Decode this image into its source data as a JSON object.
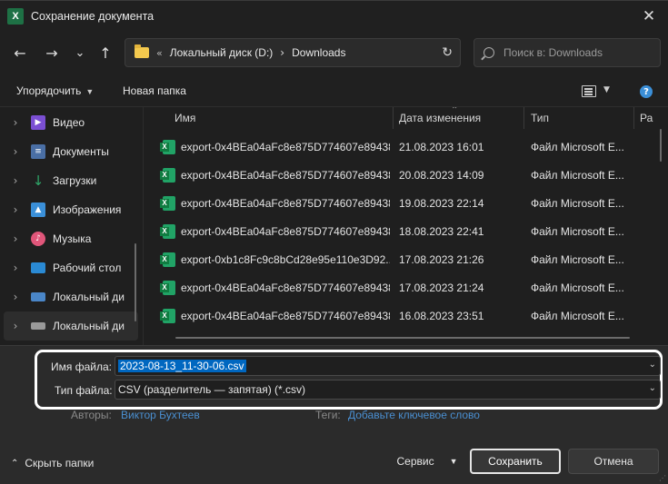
{
  "window": {
    "title": "Сохранение документа",
    "app_icon": "X"
  },
  "nav": {
    "back": "←",
    "forward": "→",
    "recent": "⌄",
    "up": "↑",
    "path": [
      "Локальный диск (D:)",
      "Downloads"
    ],
    "overflow": "«",
    "search_placeholder": "Поиск в: Downloads"
  },
  "toolbar": {
    "organize": "Упорядочить",
    "new_folder": "Новая папка",
    "help": "?"
  },
  "sidebar": {
    "items": [
      {
        "label": "Видео",
        "icon": "video-icon",
        "color": "#7b4fd3"
      },
      {
        "label": "Документы",
        "icon": "documents-icon",
        "color": "#4a6fa5"
      },
      {
        "label": "Загрузки",
        "icon": "downloads-icon",
        "color": "#2fa86a"
      },
      {
        "label": "Изображения",
        "icon": "pictures-icon",
        "color": "#3a8fd8"
      },
      {
        "label": "Музыка",
        "icon": "music-icon",
        "color": "#e0567a"
      },
      {
        "label": "Рабочий стол",
        "icon": "desktop-icon",
        "color": "#2a8ad4"
      },
      {
        "label": "Локальный ди",
        "icon": "drive-icon",
        "color": "#4a86c8"
      },
      {
        "label": "Локальный ди",
        "icon": "drive-icon",
        "color": "#9a9a9a"
      }
    ]
  },
  "filelist": {
    "columns": [
      "Имя",
      "Дата изменения",
      "Тип",
      "Ра"
    ],
    "rows": [
      {
        "name": "export-0x4BEa04aFc8e875D774607e89438...",
        "date": "21.08.2023 16:01",
        "type": "Файл Microsoft E..."
      },
      {
        "name": "export-0x4BEa04aFc8e875D774607e89438...",
        "date": "20.08.2023 14:09",
        "type": "Файл Microsoft E..."
      },
      {
        "name": "export-0x4BEa04aFc8e875D774607e89438...",
        "date": "19.08.2023 22:14",
        "type": "Файл Microsoft E..."
      },
      {
        "name": "export-0x4BEa04aFc8e875D774607e89438...",
        "date": "18.08.2023 22:41",
        "type": "Файл Microsoft E..."
      },
      {
        "name": "export-0xb1c8Fc9c8bCd28e95e110e3D92...",
        "date": "17.08.2023 21:26",
        "type": "Файл Microsoft E..."
      },
      {
        "name": "export-0x4BEa04aFc8e875D774607e89438...",
        "date": "17.08.2023 21:24",
        "type": "Файл Microsoft E..."
      },
      {
        "name": "export-0x4BEa04aFc8e875D774607e89438...",
        "date": "16.08.2023 23:51",
        "type": "Файл Microsoft E..."
      }
    ]
  },
  "form": {
    "filename_label": "Имя файла:",
    "filename_value": "2023-08-13_11-30-06.csv",
    "filetype_label": "Тип файла:",
    "filetype_value": "CSV (разделитель — запятая) (*.csv)",
    "authors_label": "Авторы:",
    "authors_value": "Виктор Бухтеев",
    "tags_label": "Теги:",
    "tags_value": "Добавьте ключевое слово"
  },
  "footer": {
    "hide_folders": "Скрыть папки",
    "service": "Сервис",
    "save": "Сохранить",
    "cancel": "Отмена"
  },
  "colors": {
    "accent": "#0067c0",
    "link": "#4a8fd1",
    "excel": "#21a366"
  }
}
